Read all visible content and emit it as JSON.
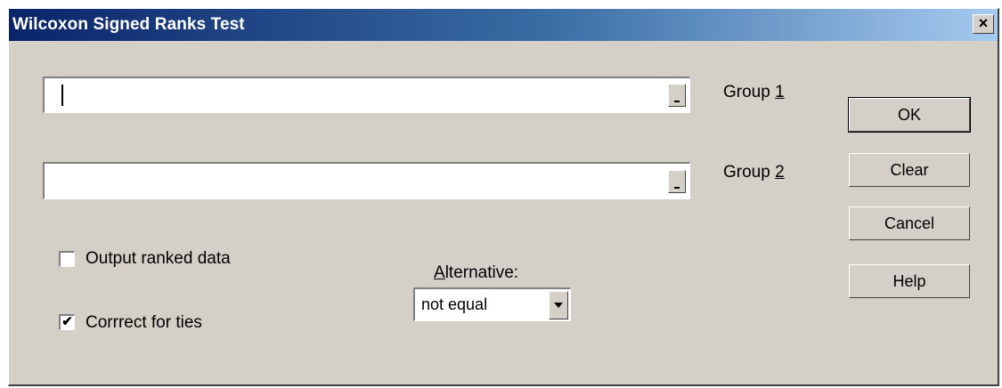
{
  "window": {
    "title": "Wilcoxon Signed Ranks Test",
    "close_glyph": "×"
  },
  "group1": {
    "label_prefix": "Group ",
    "label_key": "1",
    "value": ""
  },
  "group2": {
    "label_prefix": "Group ",
    "label_key": "2",
    "value": ""
  },
  "buttons": {
    "ok": "OK",
    "clear": "Clear",
    "cancel": "Cancel",
    "help": "Help"
  },
  "options": {
    "output_ranked": {
      "label": "Output ranked data",
      "checked": false
    },
    "correct_ties": {
      "label": "Corrrect for ties",
      "checked": true,
      "mark": "✔"
    }
  },
  "alternative": {
    "label_key": "A",
    "label_rest": "lternative:",
    "value": "not equal"
  },
  "icons": {
    "refedit": "collapse-dialog-icon",
    "dropdown": "chevron-down-icon",
    "close": "close-icon"
  }
}
